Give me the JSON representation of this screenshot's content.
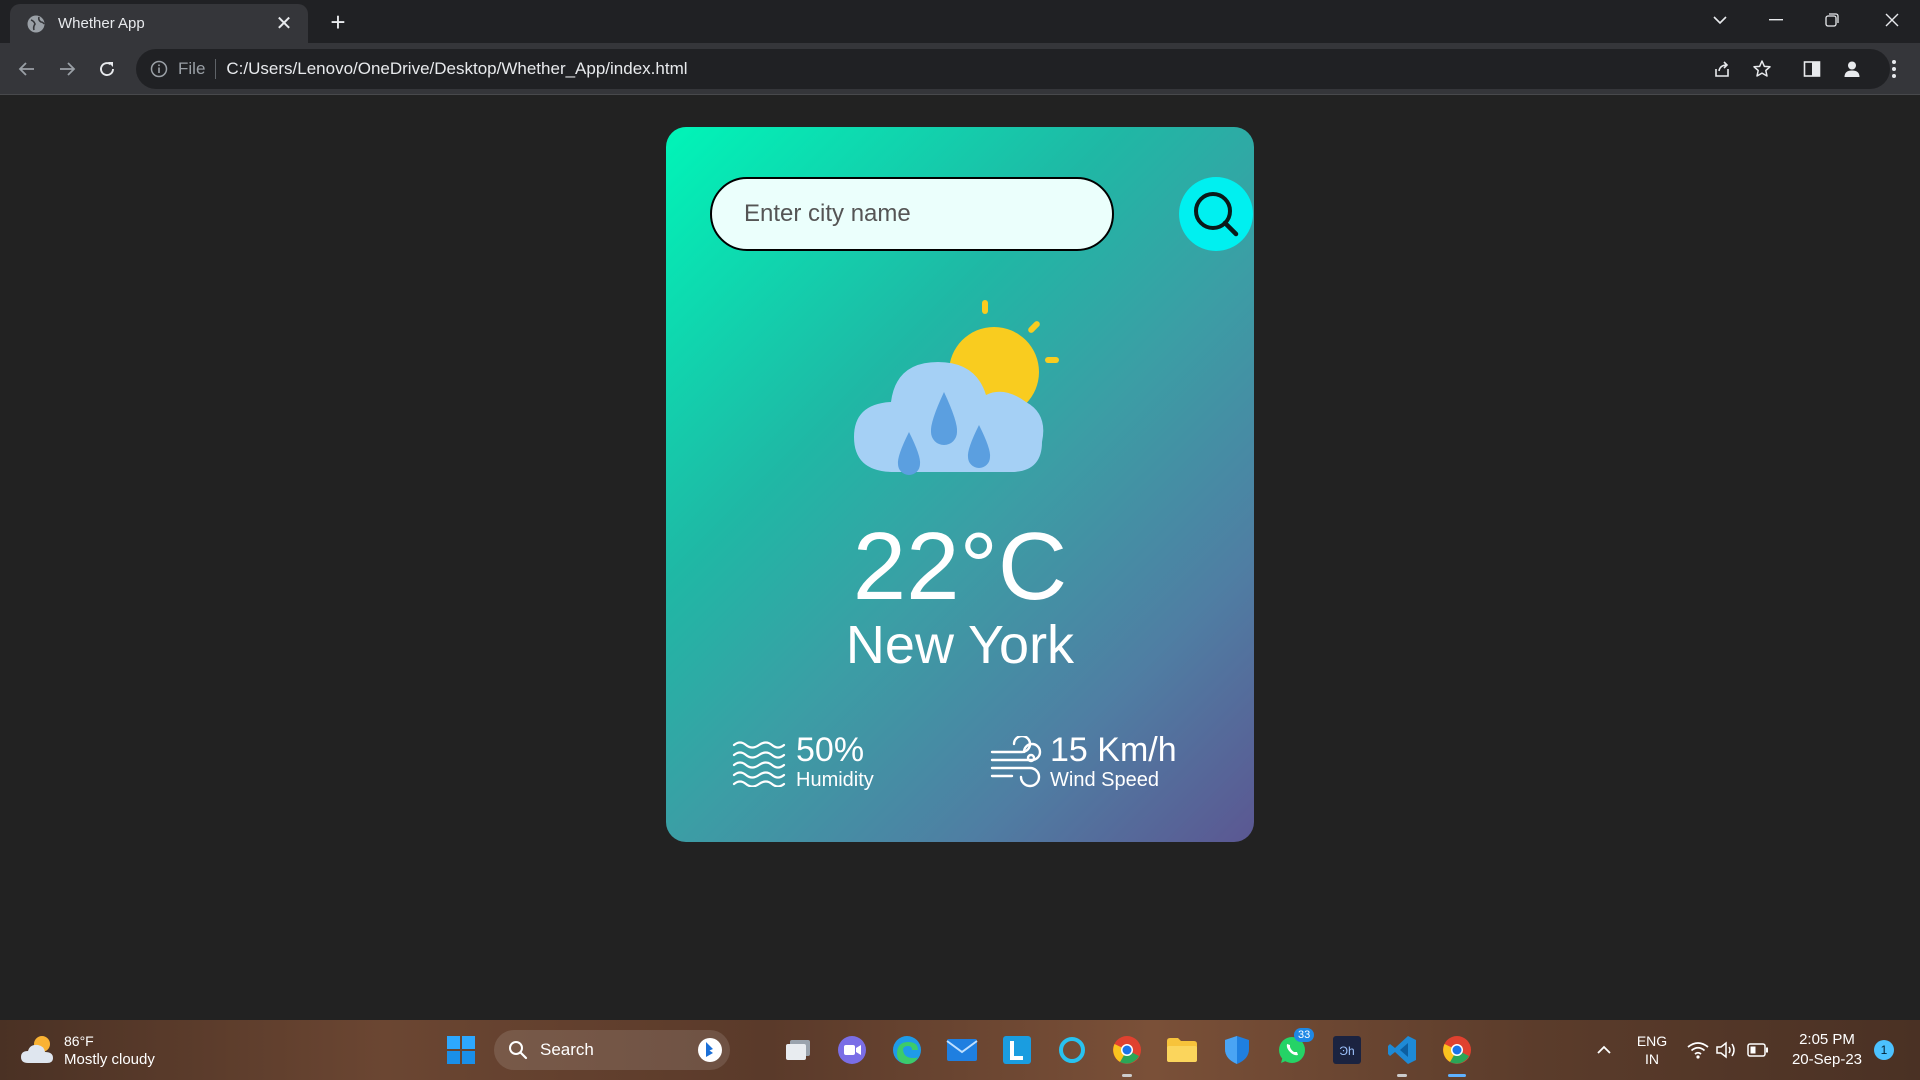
{
  "browser": {
    "tab_title": "Whether App",
    "url_scheme": "File",
    "url": "C:/Users/Lenovo/OneDrive/Desktop/Whether_App/index.html"
  },
  "app": {
    "search": {
      "placeholder": "Enter city name"
    },
    "temperature": "22°C",
    "city": "New York",
    "humidity": {
      "value": "50%",
      "label": "Humidity"
    },
    "wind": {
      "value": "15 Km/h",
      "label": "Wind Speed"
    },
    "colors": {
      "card_top": "#00f5b8",
      "card_bottom": "#5b5792",
      "search_button": "#00f0f0"
    },
    "icons": {
      "weather": "cloud-sun-rain-icon",
      "humidity": "humidity-waves-icon",
      "wind": "wind-icon",
      "search": "search-icon"
    }
  },
  "taskbar": {
    "weather_temp": "86°F",
    "weather_desc": "Mostly cloudy",
    "search_label": "Search",
    "whatsapp_badge": "33",
    "lang_1": "ENG",
    "lang_2": "IN",
    "time": "2:05 PM",
    "date": "20-Sep-23",
    "notification_count": "1"
  }
}
